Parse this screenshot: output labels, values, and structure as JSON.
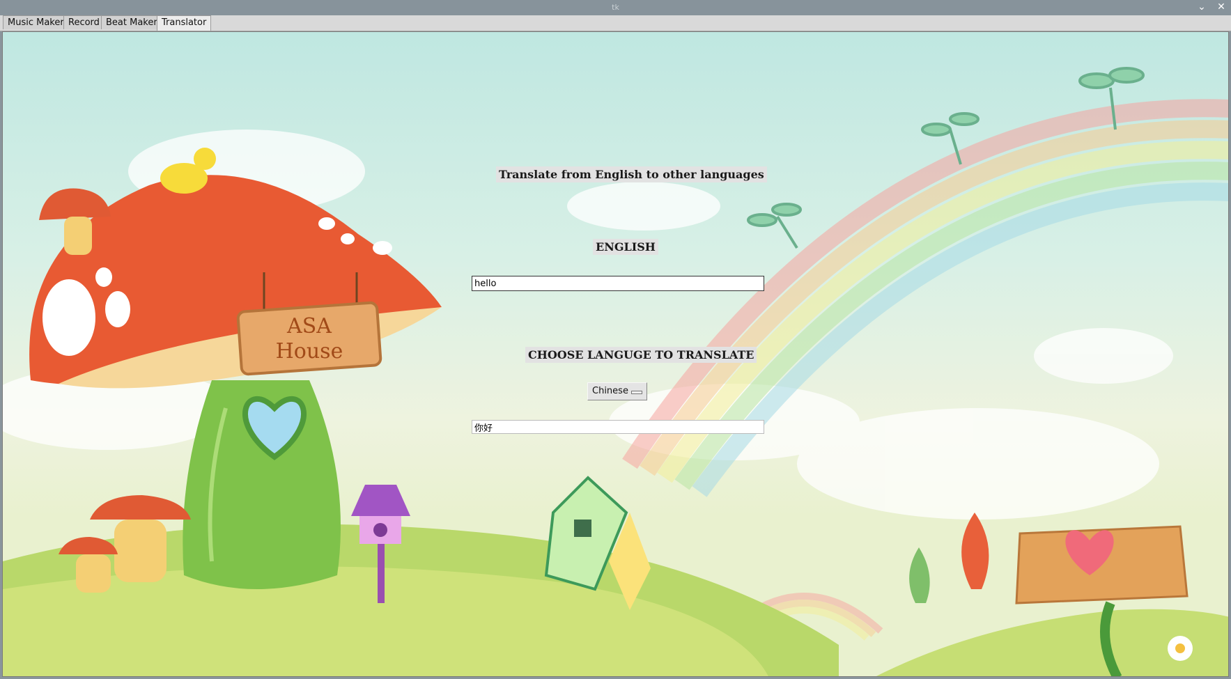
{
  "window": {
    "title": "tk"
  },
  "tabs": [
    {
      "label": "Music Maker"
    },
    {
      "label": "Record"
    },
    {
      "label": "Beat Maker"
    },
    {
      "label": "Translator",
      "active": true
    }
  ],
  "translator": {
    "heading": "Translate from English to other languages",
    "source_label": "ENGLISH",
    "source_value": "hello",
    "choose_label": "CHOOSE LANGUGE TO TRANSLATE",
    "language_selected": "Chinese",
    "output_value": "你好"
  },
  "background": {
    "sign_text_line1": "ASA",
    "sign_text_line2": "House"
  },
  "icons": {
    "minimize": "chevron-down-icon",
    "close": "close-icon"
  }
}
